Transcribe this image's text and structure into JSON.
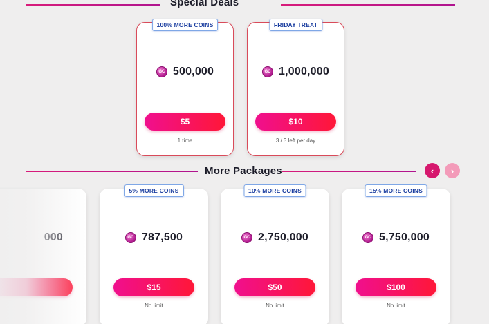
{
  "special": {
    "title": "Special Deals",
    "cards": [
      {
        "badge": "100% MORE COINS",
        "icon_text": "GC",
        "amount": "500,000",
        "price": "$5",
        "limit": "1 time"
      },
      {
        "badge": "FRIDAY TREAT",
        "icon_text": "GC",
        "amount": "1,000,000",
        "price": "$10",
        "limit": "3 / 3 left per day"
      }
    ]
  },
  "more": {
    "title": "More Packages",
    "prev_icon": "chevron-left-icon",
    "next_icon": "chevron-right-icon",
    "prev_glyph": "‹",
    "next_glyph": "›",
    "partial_card": {
      "amount": "000"
    },
    "cards": [
      {
        "badge": "5% MORE COINS",
        "icon_text": "GC",
        "amount": "787,500",
        "price": "$15",
        "limit": "No limit"
      },
      {
        "badge": "10% MORE COINS",
        "icon_text": "GC",
        "amount": "2,750,000",
        "price": "$50",
        "limit": "No limit"
      },
      {
        "badge": "15% MORE COINS",
        "icon_text": "GC",
        "amount": "5,750,000",
        "price": "$100",
        "limit": "No limit"
      }
    ]
  },
  "colors": {
    "accent": "#e8127a",
    "button_start": "#f00f8e",
    "button_end": "#ff1738",
    "badge_text": "#1c3fa0"
  }
}
